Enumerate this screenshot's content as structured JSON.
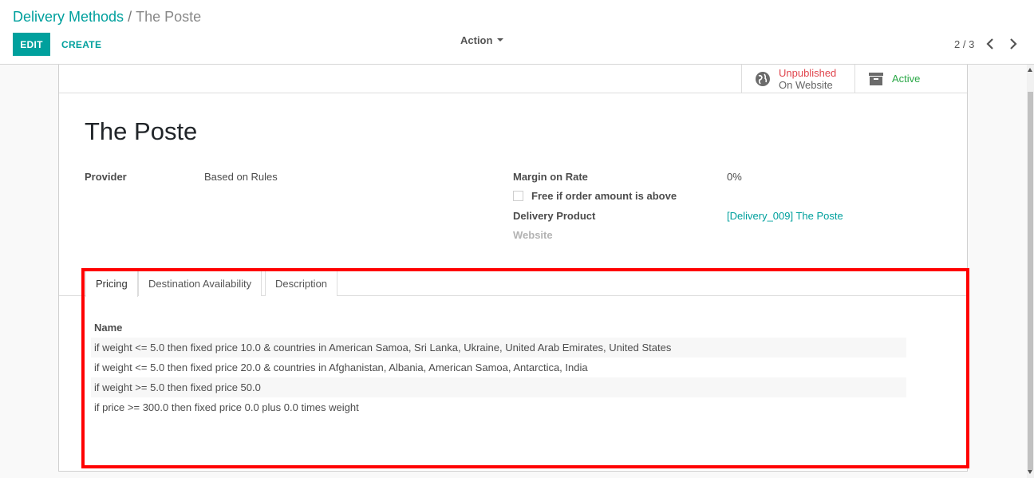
{
  "breadcrumb": {
    "parent": "Delivery Methods",
    "separator": "/",
    "current": "The Poste"
  },
  "toolbar": {
    "edit_label": "EDIT",
    "create_label": "CREATE",
    "action_label": "Action"
  },
  "pager": {
    "value": "2 / 3"
  },
  "smart_buttons": {
    "website": {
      "line1": "Unpublished",
      "line2": "On Website",
      "icon": "globe-icon"
    },
    "active": {
      "label": "Active",
      "icon": "archive-icon"
    }
  },
  "record": {
    "title": "The Poste",
    "provider_label": "Provider",
    "provider_value": "Based on Rules",
    "margin_label": "Margin on Rate",
    "margin_value": "0%",
    "free_label": "Free if order amount is above",
    "delivery_product_label": "Delivery Product",
    "delivery_product_value": "[Delivery_009] The Poste",
    "website_label": "Website"
  },
  "tabs": [
    {
      "label": "Pricing",
      "active": true
    },
    {
      "label": "Destination Availability",
      "active": false
    },
    {
      "label": "Description",
      "active": false
    }
  ],
  "pricing": {
    "column_header": "Name",
    "rows": [
      "if weight <= 5.0 then fixed price 10.0 & countries in American Samoa, Sri Lanka, Ukraine, United Arab Emirates, United States",
      "if weight <= 5.0 then fixed price 20.0 & countries in Afghanistan, Albania, American Samoa, Antarctica, India",
      "if weight >= 5.0 then fixed price 50.0",
      "if price >= 300.0 then fixed price 0.0 plus 0.0 times weight"
    ]
  },
  "colors": {
    "accent": "#00A09D",
    "unpublished": "#e0464e",
    "active": "#28a745",
    "highlight": "#ff0000"
  }
}
